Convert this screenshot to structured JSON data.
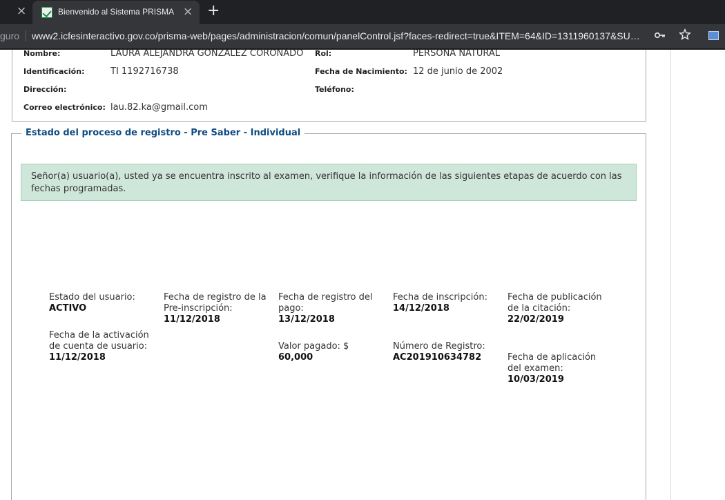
{
  "browser": {
    "prev_tab_close": "×",
    "tab_title": "Bienvenido al Sistema PRISMA",
    "tab_close": "×",
    "new_tab": "+",
    "address_prefix": "guro",
    "url": "www2.icfesinteractivo.gov.co/prisma-web/pages/administracion/comun/panelControl.jsf?faces-redirect=true&ITEM=64&ID=1311960137&SU…",
    "key_icon": "key-icon",
    "star_icon": "star-icon"
  },
  "person": {
    "nombre_label": "Nombre:",
    "nombre_value": "LAURA ALEJANDRA GONZALEZ CORONADO",
    "rol_label": "Rol:",
    "rol_value": "PERSONA NATURAL",
    "id_label": "Identificación:",
    "id_value": "TI 1192716738",
    "fecha_nac_label": "Fecha de Nacimiento:",
    "fecha_nac_value": "12 de junio de 2002",
    "direccion_label": "Dirección:",
    "telefono_label": "Teléfono:",
    "correo_label": "Correo electrónico:",
    "correo_value": "lau.82.ka@gmail.com"
  },
  "process": {
    "legend": "Estado del proceso de registro - Pre Saber - Individual",
    "alert": "Señor(a) usuario(a), usted ya se encuentra inscrito al examen, verifique la información de las siguientes etapas de acuerdo con las fechas programadas.",
    "estado_usuario_label": "Estado del usuario:",
    "estado_usuario_value": "ACTIVO",
    "activacion_label": "Fecha de la activación de cuenta de usuario:",
    "activacion_value": "11/12/2018",
    "preinscripcion_label": "Fecha de registro de la Pre-inscripción:",
    "preinscripcion_value": "11/12/2018",
    "registro_pago_label": "Fecha de registro del pago:",
    "registro_pago_value": "13/12/2018",
    "valor_pagado_label": "Valor pagado: $",
    "valor_pagado_value": "60,000",
    "inscripcion_label": "Fecha de inscripción:",
    "inscripcion_value": "14/12/2018",
    "numero_registro_label": "Número de Registro:",
    "numero_registro_value": "AC201910634782",
    "citacion_label": "Fecha de publicación de la citación:",
    "citacion_value": "22/02/2019",
    "aplicacion_label": "Fecha de aplicación del examen:",
    "aplicacion_value": "10/03/2019"
  }
}
